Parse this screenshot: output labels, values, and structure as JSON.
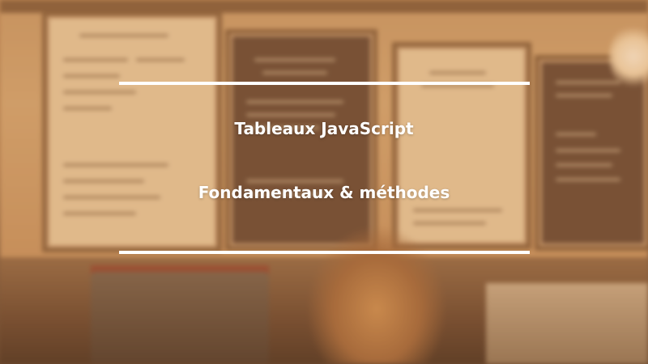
{
  "title": {
    "line1": "Tableaux JavaScript",
    "line2": "Fondamentaux & méthodes"
  },
  "colors": {
    "text": "#ffffff",
    "rule": "#ffffff",
    "tint": "#c88246"
  }
}
